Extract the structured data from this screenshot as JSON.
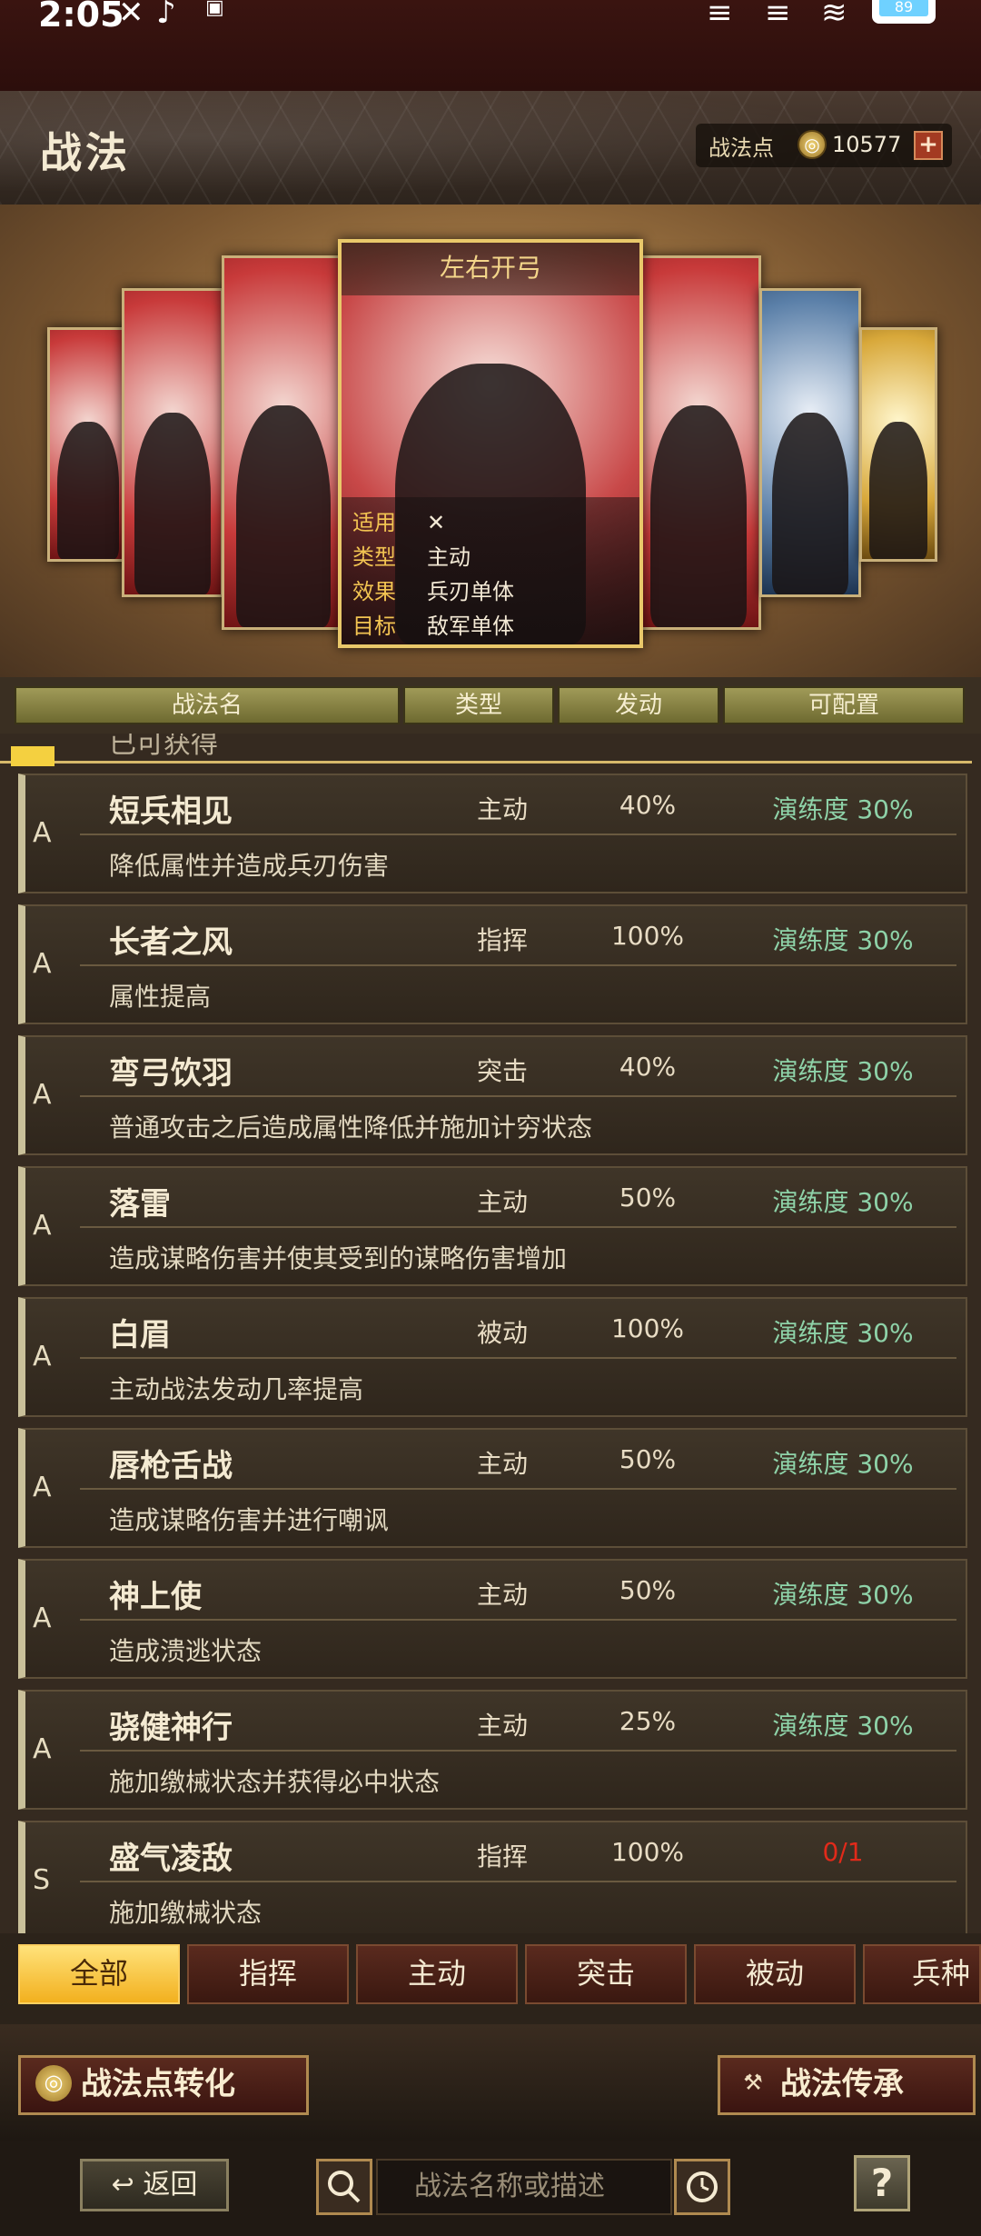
{
  "status_bar": {
    "time": "2:05",
    "battery": "89"
  },
  "header": {
    "title": "战法",
    "points_label": "战法点",
    "points_value": "10577",
    "add_icon": "plus-icon"
  },
  "featured_card": {
    "title": "左右开弓",
    "info": [
      {
        "key": "适用",
        "value": ""
      },
      {
        "key": "类型",
        "value": "主动"
      },
      {
        "key": "效果",
        "value": "兵刃单体"
      },
      {
        "key": "目标",
        "value": "敌军单体"
      }
    ]
  },
  "table": {
    "headers": [
      "战法名",
      "类型",
      "发动",
      "可配置"
    ],
    "partial_row_text": "已可获得",
    "rows": [
      {
        "grade": "A",
        "name": "短兵相见",
        "type": "主动",
        "rate": "40%",
        "status": "演练度 30%",
        "desc": "降低属性并造成兵刃伤害"
      },
      {
        "grade": "A",
        "name": "长者之风",
        "type": "指挥",
        "rate": "100%",
        "status": "演练度 30%",
        "desc": "属性提高"
      },
      {
        "grade": "A",
        "name": "弯弓饮羽",
        "type": "突击",
        "rate": "40%",
        "status": "演练度 30%",
        "desc": "普通攻击之后造成属性降低并施加计穷状态"
      },
      {
        "grade": "A",
        "name": "落雷",
        "type": "主动",
        "rate": "50%",
        "status": "演练度 30%",
        "desc": "造成谋略伤害并使其受到的谋略伤害增加"
      },
      {
        "grade": "A",
        "name": "白眉",
        "type": "被动",
        "rate": "100%",
        "status": "演练度 30%",
        "desc": "主动战法发动几率提高"
      },
      {
        "grade": "A",
        "name": "唇枪舌战",
        "type": "主动",
        "rate": "50%",
        "status": "演练度 30%",
        "desc": "造成谋略伤害并进行嘲讽"
      },
      {
        "grade": "A",
        "name": "神上使",
        "type": "主动",
        "rate": "50%",
        "status": "演练度 30%",
        "desc": "造成溃逃状态"
      },
      {
        "grade": "A",
        "name": "骁健神行",
        "type": "主动",
        "rate": "25%",
        "status": "演练度 30%",
        "desc": "施加缴械状态并获得必中状态"
      },
      {
        "grade": "S",
        "name": "盛气凌敌",
        "type": "指挥",
        "rate": "100%",
        "status": "0/1",
        "desc": "施加缴械状态"
      }
    ]
  },
  "tabs": [
    "全部",
    "指挥",
    "主动",
    "突击",
    "被动",
    "兵种"
  ],
  "actions": {
    "convert": "战法点转化",
    "inherit": "战法传承"
  },
  "footer": {
    "back": "返回",
    "search_placeholder": "战法名称或描述",
    "help": "?"
  },
  "colors": {
    "accent_gold": "#f2b01e",
    "status_green": "#8ed2a8",
    "status_red": "#e12a1a"
  }
}
